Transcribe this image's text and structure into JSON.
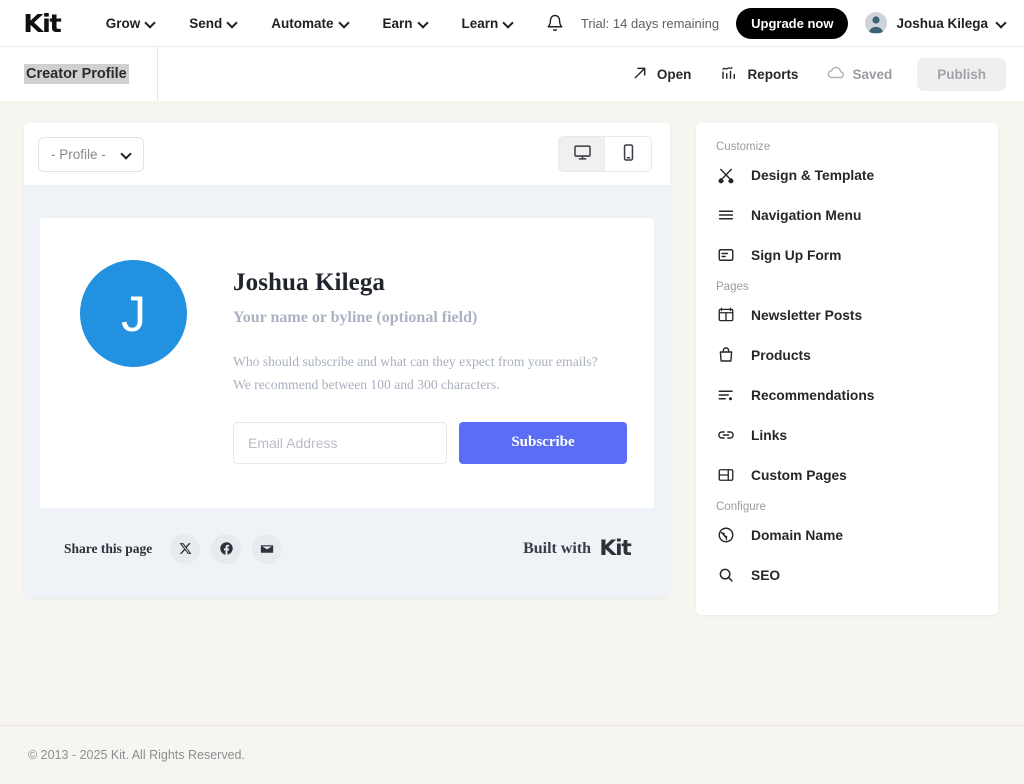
{
  "topnav": {
    "logo": "Kit",
    "links": [
      {
        "label": "Grow",
        "icon": "chevron-down-icon"
      },
      {
        "label": "Send",
        "icon": "chevron-down-icon"
      },
      {
        "label": "Automate",
        "icon": "chevron-down-icon"
      },
      {
        "label": "Earn",
        "icon": "chevron-down-icon"
      },
      {
        "label": "Learn",
        "icon": "chevron-down-icon"
      }
    ],
    "notifications_icon": "bell-icon",
    "trial_text": "Trial: 14 days remaining",
    "upgrade_label": "Upgrade now",
    "user_name": "Joshua Kilega",
    "user_avatar_icon": "user-avatar-icon",
    "user_chevron_icon": "chevron-down-icon"
  },
  "subbar": {
    "title": "Creator Profile",
    "open_label": "Open",
    "open_icon": "external-link-arrow-icon",
    "reports_label": "Reports",
    "reports_icon": "chart-bars-icon",
    "saved_label": "Saved",
    "saved_icon": "cloud-check-icon",
    "publish_label": "Publish"
  },
  "preview": {
    "profile_select_value": "- Profile -",
    "profile_select_icon": "chevron-down-icon",
    "device_desktop_icon": "desktop-monitor-icon",
    "device_mobile_icon": "mobile-phone-icon",
    "device_active": "desktop",
    "card": {
      "avatar_initial": "J",
      "avatar_color": "#2191e0",
      "name": "Joshua Kilega",
      "byline": "Your name or byline (optional field)",
      "description": "Who should subscribe and what can they expect from your emails? We recommend between 100 and 300 characters.",
      "email_placeholder": "Email Address",
      "email_value": "",
      "subscribe_label": "Subscribe",
      "subscribe_color": "#5b6cf5"
    },
    "share": {
      "label": "Share this page",
      "icons": [
        {
          "name": "x-twitter-icon"
        },
        {
          "name": "facebook-icon"
        },
        {
          "name": "email-envelope-icon"
        }
      ],
      "built_with_label": "Built with",
      "built_with_brand": "Kit"
    }
  },
  "sidebar": {
    "groups": [
      {
        "title": "Customize",
        "items": [
          {
            "label": "Design & Template",
            "icon": "design-brush-pencil-icon"
          },
          {
            "label": "Navigation Menu",
            "icon": "menu-lines-icon"
          },
          {
            "label": "Sign Up Form",
            "icon": "form-card-icon"
          }
        ]
      },
      {
        "title": "Pages",
        "items": [
          {
            "label": "Newsletter Posts",
            "icon": "newsletter-layout-icon"
          },
          {
            "label": "Products",
            "icon": "shopping-bag-icon"
          },
          {
            "label": "Recommendations",
            "icon": "list-recommend-icon"
          },
          {
            "label": "Links",
            "icon": "link-chain-icon"
          },
          {
            "label": "Custom Pages",
            "icon": "custom-page-layout-icon"
          }
        ]
      },
      {
        "title": "Configure",
        "items": [
          {
            "label": "Domain Name",
            "icon": "globe-icon"
          },
          {
            "label": "SEO",
            "icon": "search-icon"
          }
        ]
      }
    ]
  },
  "footer": {
    "copyright": "© 2013 - 2025 Kit. All Rights Reserved."
  }
}
